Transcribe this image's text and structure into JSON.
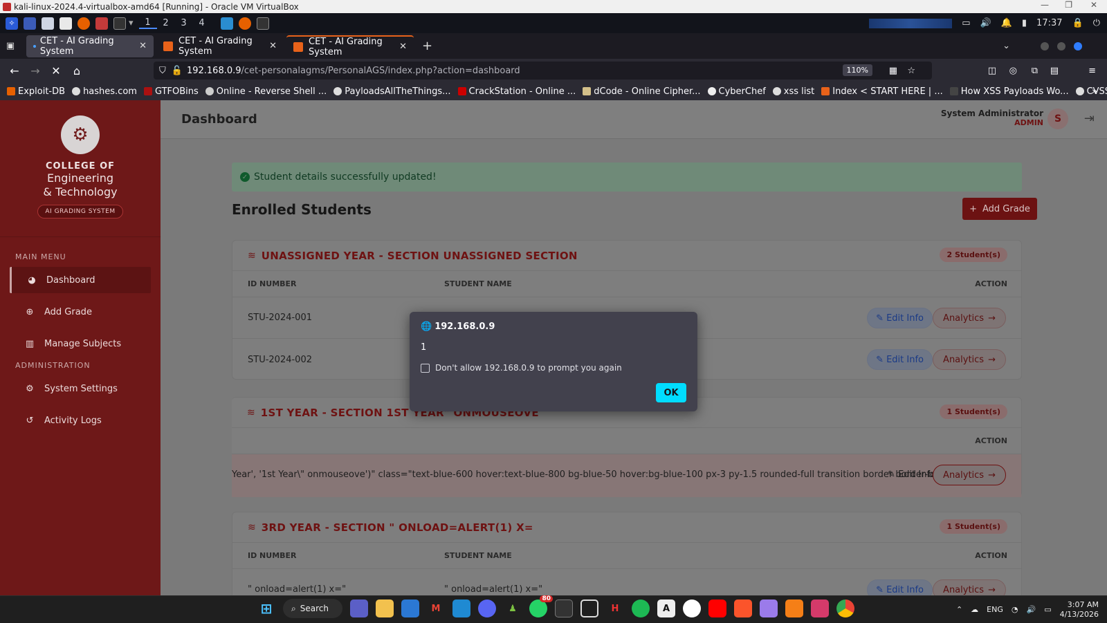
{
  "vbox": {
    "title": "kali-linux-2024.4-virtualbox-amd64 [Running] - Oracle VM VirtualBox"
  },
  "kali_panel": {
    "workspaces": [
      "1",
      "2",
      "3",
      "4"
    ],
    "clock": "17:37"
  },
  "browser": {
    "tabs": [
      {
        "label": "CET - AI Grading System"
      },
      {
        "label": "CET - AI Grading System"
      },
      {
        "label": "CET - AI Grading System"
      }
    ],
    "url_host": "192.168.0.9",
    "url_path": "/cet-personalagms/PersonalAGS/index.php?action=dashboard",
    "zoom": "110%",
    "bookmarks": [
      "Exploit-DB",
      "hashes.com",
      "GTFOBins",
      "Online - Reverse Shell ...",
      "PayloadsAllTheThings...",
      "CrackStation - Online ...",
      "dCode - Online Cipher...",
      "CyberChef",
      "xss list",
      "Index < START HERE | ...",
      "How XSS Payloads Wo...",
      "CVSS Advisor: A tool t..."
    ]
  },
  "sidebar": {
    "brand_line1": "COLLEGE OF",
    "brand_line2": "Engineering",
    "brand_line3": "& Technology",
    "brand_badge": "AI GRADING SYSTEM",
    "main_menu_label": "MAIN MENU",
    "admin_label": "ADMINISTRATION",
    "items": {
      "dashboard": "Dashboard",
      "add_grade": "Add Grade",
      "manage_subjects": "Manage Subjects",
      "system_settings": "System Settings",
      "activity_logs": "Activity Logs"
    }
  },
  "header": {
    "title": "Dashboard",
    "user_name": "System Administrator",
    "user_role": "ADMIN",
    "avatar_letter": "S"
  },
  "main": {
    "alert": "Student details successfully updated!",
    "heading": "Enrolled Students",
    "add_grade_btn": "Add Grade",
    "col_id": "ID NUMBER",
    "col_name": "STUDENT NAME",
    "col_action": "ACTION",
    "edit_label": "Edit Info",
    "analytics_label": "Analytics",
    "sections": [
      {
        "title": "UNASSIGNED YEAR - SECTION UNASSIGNED SECTION",
        "count": "2 Student(s)",
        "rows": [
          {
            "id": "STU-2024-001",
            "name": ""
          },
          {
            "id": "STU-2024-002",
            "name": ""
          }
        ]
      },
      {
        "title": "1ST YEAR - SECTION 1ST YEAR\" ONMOUSEOVE",
        "count": "1 Student(s)",
        "raw": "Year', '1st Year\\\" onmouseove')\" class=\"text-blue-600 hover:text-blue-800 bg-blue-50 hover:bg-blue-100 px-3 py-1.5 rounded-full transition border border-blue-100 mr-2\">"
      },
      {
        "title": "3RD YEAR - SECTION \" ONLOAD=ALERT(1) X=",
        "count": "1 Student(s)",
        "rows": [
          {
            "id": "\" onload=alert(1) x=\"",
            "name": "\" onload=alert(1) x=\""
          }
        ]
      }
    ]
  },
  "dialog": {
    "origin": "192.168.0.9",
    "message": "1",
    "checkbox": "Don't allow 192.168.0.9 to prompt you again",
    "ok": "OK"
  },
  "taskbar": {
    "search": "Search",
    "lang": "ENG",
    "time": "3:07 AM",
    "date": "4/13/2026",
    "whatsapp_badge": "80"
  }
}
